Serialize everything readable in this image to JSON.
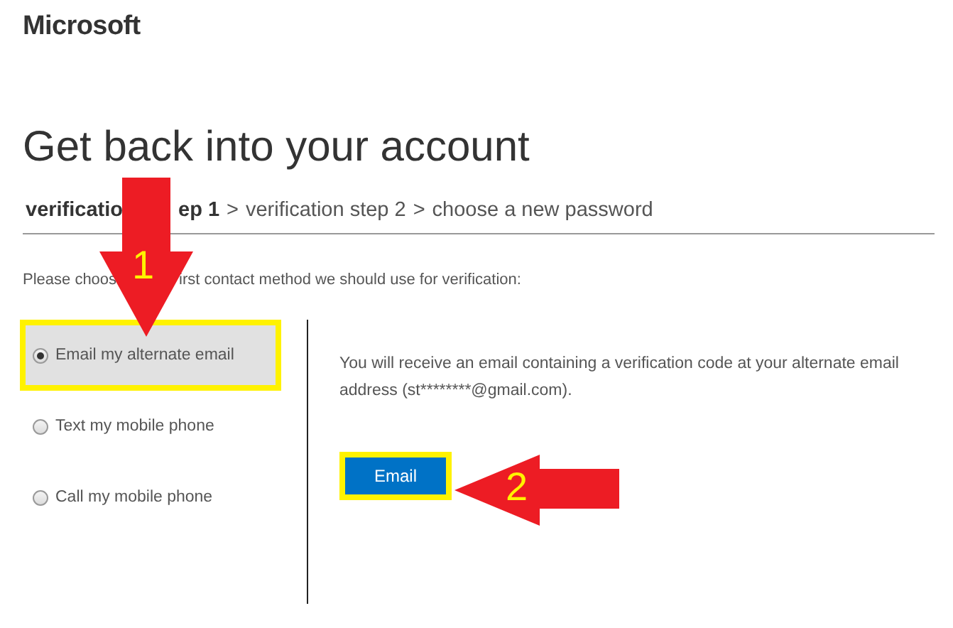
{
  "brand": "Microsoft",
  "title": "Get back into your account",
  "breadcrumb": {
    "separator": ">",
    "items": [
      {
        "segments": [
          "verificatio",
          "ep 1"
        ],
        "current": true
      },
      {
        "segments": [
          "verification step 2"
        ],
        "current": false
      },
      {
        "segments": [
          "choose a new password"
        ],
        "current": false
      }
    ]
  },
  "instruction": {
    "segments": [
      "Please choos",
      "irst contact method we should use for verification:"
    ]
  },
  "options": [
    {
      "label": "Email my alternate email",
      "selected": true,
      "highlighted": true
    },
    {
      "label": "Text my mobile phone",
      "selected": false,
      "highlighted": false
    },
    {
      "label": "Call my mobile phone",
      "selected": false,
      "highlighted": false
    }
  ],
  "detail": {
    "text": "You will receive an email containing a verification code at your alternate email address (st********@gmail.com).",
    "button": {
      "label": "Email",
      "highlighted": true
    }
  },
  "annotations": [
    {
      "label": "1",
      "kind": "down"
    },
    {
      "label": "2",
      "kind": "left"
    }
  ]
}
